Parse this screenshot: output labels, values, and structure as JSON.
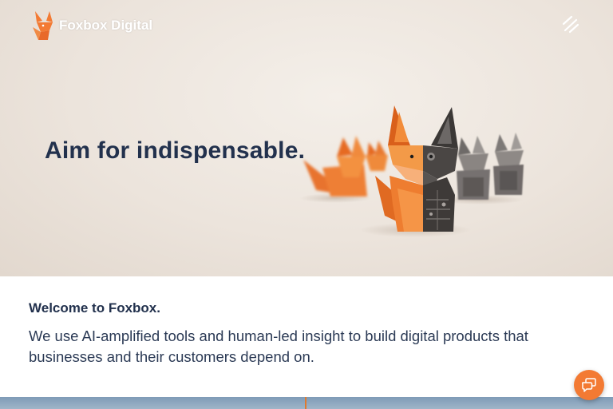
{
  "header": {
    "brand_name": "Foxbox Digital",
    "logo_icon": "fox-logo-icon",
    "menu_icon": "hamburger-menu-icon"
  },
  "hero": {
    "headline": "Aim for indispensable.",
    "image_subject": "origami-foxes-image"
  },
  "intro": {
    "heading": "Welcome to Foxbox.",
    "body": "We use AI-amplified tools and human-led insight to build digital products that businesses and their customers depend on."
  },
  "chat": {
    "icon": "chat-bubble-icon"
  },
  "colors": {
    "brand_orange": "#f37a33",
    "navy_text": "#22314d",
    "hero_background": "#ece4dc"
  }
}
